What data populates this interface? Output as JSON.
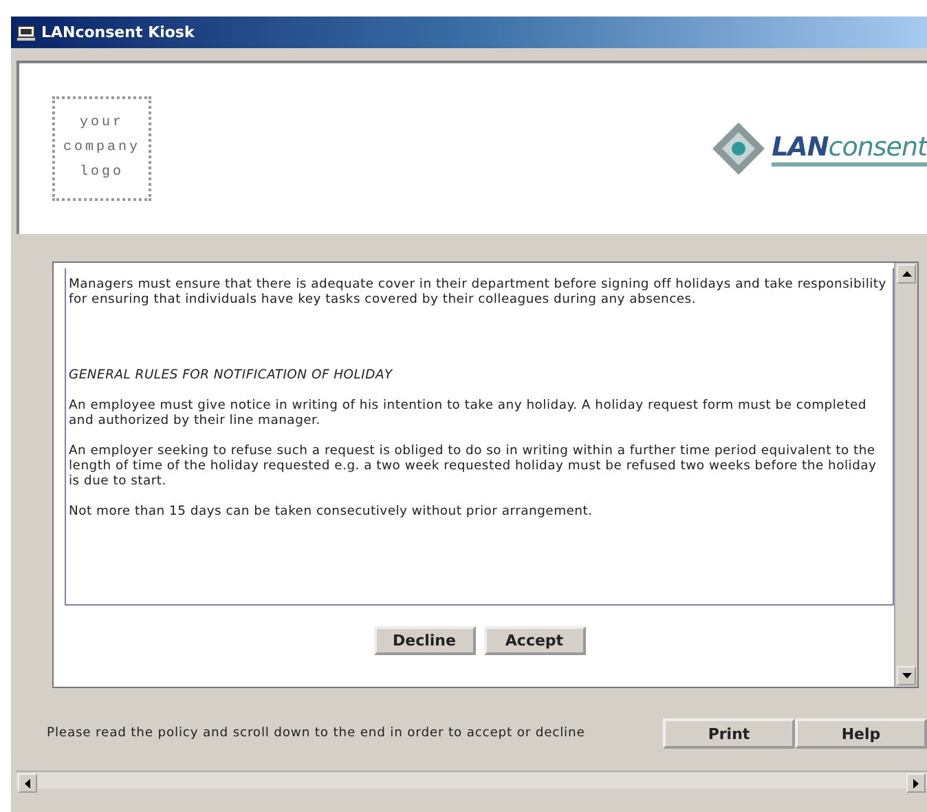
{
  "window": {
    "title": "LANconsent Kiosk"
  },
  "header": {
    "logo_placeholder": "your company logo",
    "brand": "**LAN**consent"
  },
  "policy": {
    "paragraphs": [
      {
        "kind": "body",
        "text": "Managers must ensure that there is adequate cover in their department before signing off holidays and take responsibility for ensuring that individuals have key tasks covered by their colleagues during any absences."
      },
      {
        "kind": "heading",
        "text": "GENERAL RULES FOR NOTIFICATION OF HOLIDAY"
      },
      {
        "kind": "body",
        "text": "An employee must give notice in writing of his intention to take any holiday. A holiday request form must be completed and authorized by their line manager."
      },
      {
        "kind": "body",
        "text": "An employer seeking to refuse such a request is obliged to do so in writing within a further time period equivalent to the length of time of the holiday requested e.g. a two week requested holiday must be refused two weeks before the holiday is due to start."
      },
      {
        "kind": "body",
        "text": "Not more than 15 days can be taken consecutively without prior arrangement."
      }
    ],
    "buttons": [
      "Decline",
      "Accept"
    ]
  },
  "footer": {
    "message": "Please read the policy and scroll down to the end in order to accept or decline",
    "buttons": [
      "Print",
      "Help"
    ]
  }
}
